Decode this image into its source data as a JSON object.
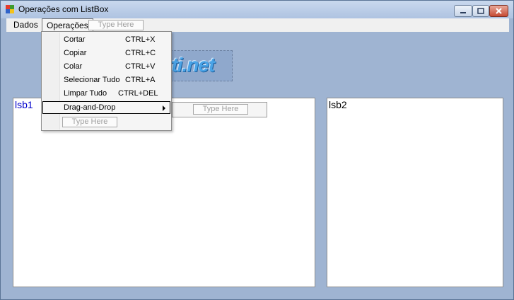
{
  "window": {
    "title": "Operações com ListBox"
  },
  "menubar": {
    "items": [
      {
        "label": "Dados"
      },
      {
        "label": "Operações"
      }
    ],
    "type_here": "Type Here"
  },
  "dropdown": {
    "items": [
      {
        "label": "Cortar",
        "shortcut": "CTRL+X"
      },
      {
        "label": "Copiar",
        "shortcut": "CTRL+C"
      },
      {
        "label": "Colar",
        "shortcut": "CTRL+V"
      },
      {
        "label": "Selecionar Tudo",
        "shortcut": "CTRL+A"
      },
      {
        "label": "Limpar Tudo",
        "shortcut": "CTRL+DEL"
      },
      {
        "label": "Drag-and-Drop",
        "shortcut": ""
      }
    ],
    "type_here": "Type Here",
    "submenu_type_here": "Type Here"
  },
  "logo": {
    "text": "tti.net"
  },
  "listboxes": {
    "left": {
      "label": "lsb1"
    },
    "right": {
      "label": "lsb2"
    }
  },
  "colors": {
    "client_bg": "#9fb4d2",
    "listbox_label": "#0000cc"
  }
}
